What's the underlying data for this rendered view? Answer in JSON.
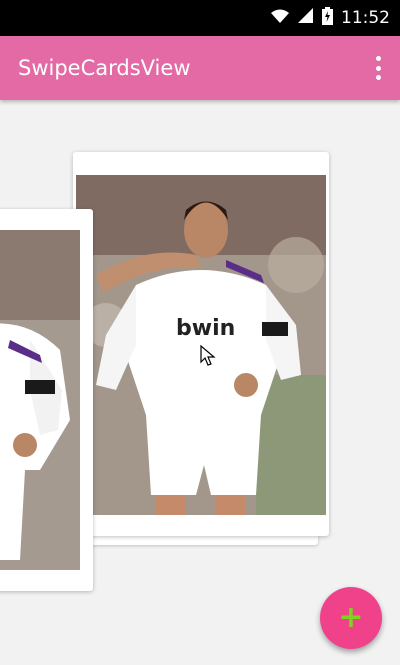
{
  "status_bar": {
    "time": "11:52",
    "icons": [
      "wifi-icon",
      "cell-signal-icon",
      "battery-charging-icon"
    ]
  },
  "app_bar": {
    "title": "SwipeCardsView",
    "menu_icon": "overflow-menu-icon"
  },
  "cards": [
    {
      "name": "front-card",
      "image": "player photo"
    },
    {
      "name": "swiped-card",
      "image": "player photo"
    }
  ],
  "fab": {
    "icon": "plus-icon",
    "label": "+",
    "color": "#f0428a",
    "icon_color": "#7ed321"
  },
  "colors": {
    "app_bar": "#e46aa5",
    "status_bar": "#000000",
    "background": "#f2f2f2"
  }
}
